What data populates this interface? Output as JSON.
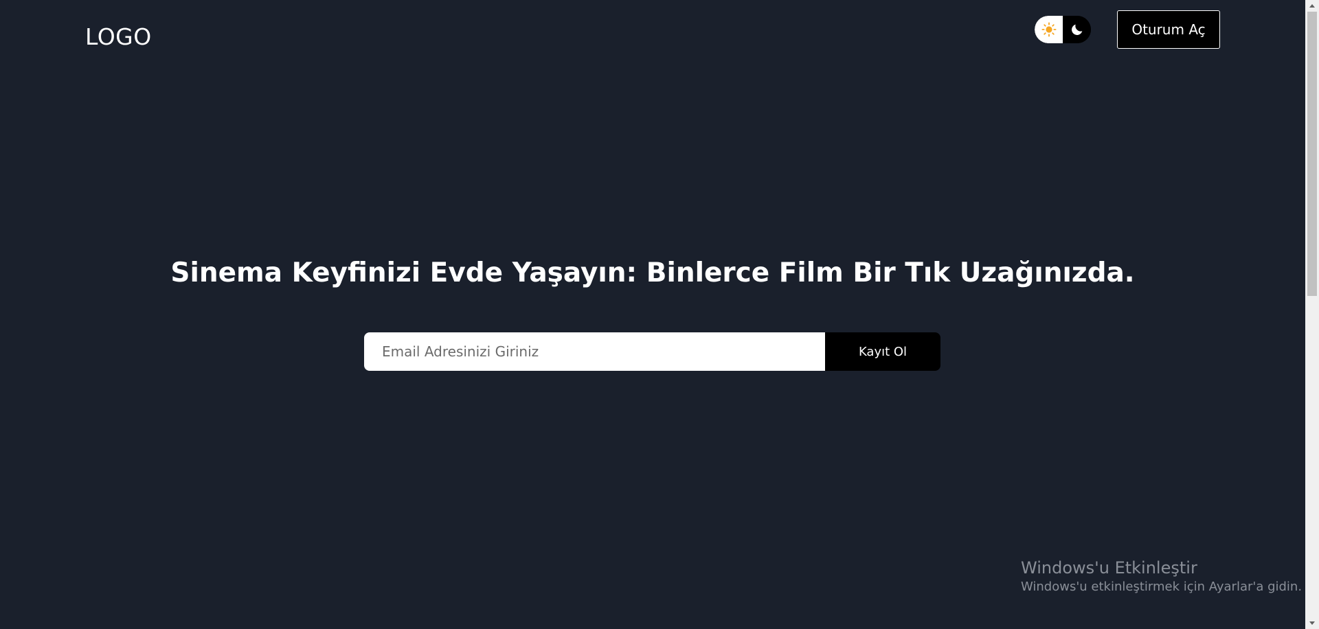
{
  "header": {
    "logo_text": "LOGO",
    "theme_toggle": {
      "light_icon": "sun-icon",
      "dark_icon": "moon-icon",
      "active": "light",
      "sun_color": "#f5a623"
    },
    "signin_label": "Oturum Aç"
  },
  "hero": {
    "headline": "Sinema Keyfinizi Evde Yaşayın: Binlerce Film Bir Tık Uzağınızda.",
    "email_placeholder": "Email Adresinizi Giriniz",
    "email_value": "",
    "signup_label": "Kayıt Ol"
  },
  "watermark": {
    "title": "Windows'u Etkinleştir",
    "subtitle": "Windows'u etkinleştirmek için Ayarlar'a gidin."
  },
  "colors": {
    "background": "#1a202c",
    "button_bg": "#000000",
    "text": "#ffffff"
  }
}
